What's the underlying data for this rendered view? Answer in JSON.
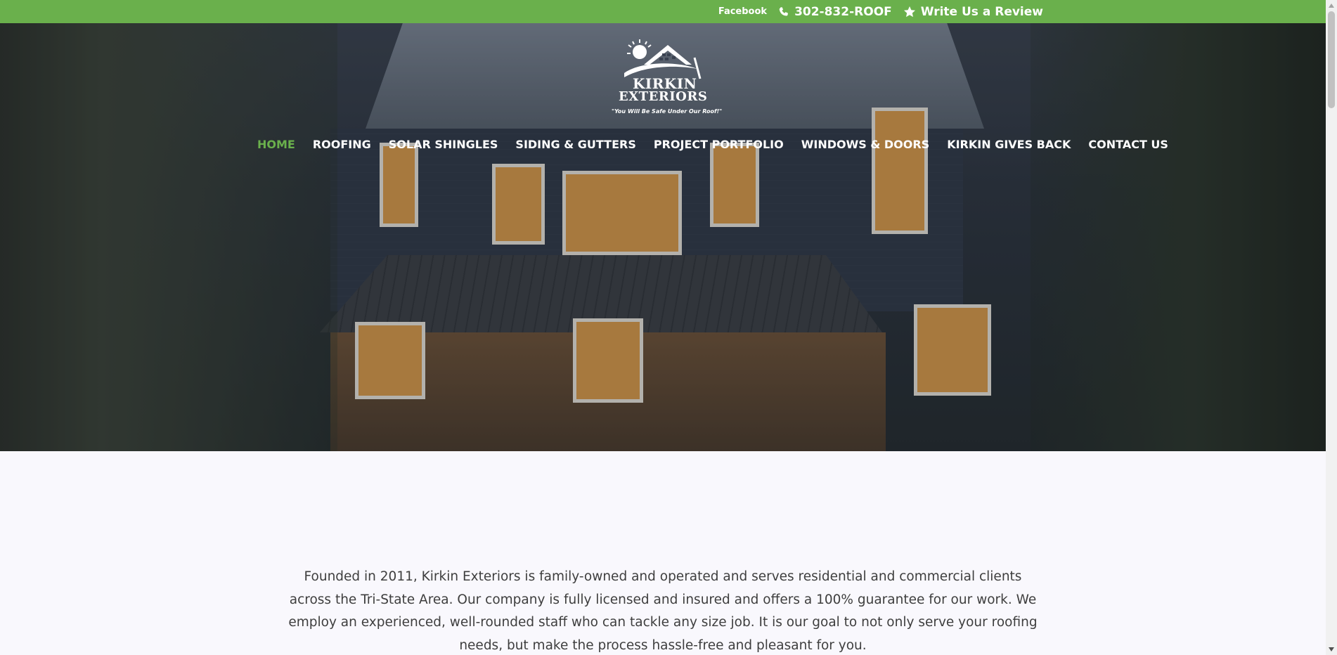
{
  "topbar": {
    "facebook": "Facebook",
    "phone": "302-832-ROOF",
    "review": "Write Us a Review",
    "phone_icon": "phone-icon",
    "star_icon": "star-icon",
    "background": "#6ab04c"
  },
  "logo": {
    "line1": "KIRKIN",
    "line2": "EXTERIORS",
    "tagline": "\"You Will Be Safe Under Our Roof!\""
  },
  "nav": {
    "items": [
      {
        "label": "HOME",
        "active": true
      },
      {
        "label": "ROOFING"
      },
      {
        "label": "SOLAR SHINGLES"
      },
      {
        "label": "SIDING & GUTTERS"
      },
      {
        "label": "PROJECT PORTFOLIO"
      },
      {
        "label": "WINDOWS & DOORS"
      },
      {
        "label": "KIRKIN GIVES BACK"
      },
      {
        "label": "CONTACT US"
      }
    ],
    "active_color": "#6ab04c"
  },
  "intro": {
    "text": "Founded in 2011, Kirkin Exteriors is family-owned and operated and serves residential and commercial clients across the Tri-State Area. Our company is fully licensed and insured and offers a 100% guarantee for our work. We employ an experienced, well-rounded staff who can tackle any size job. It is our goal to not only serve your roofing needs, but make the process hassle-free and pleasant for you."
  }
}
